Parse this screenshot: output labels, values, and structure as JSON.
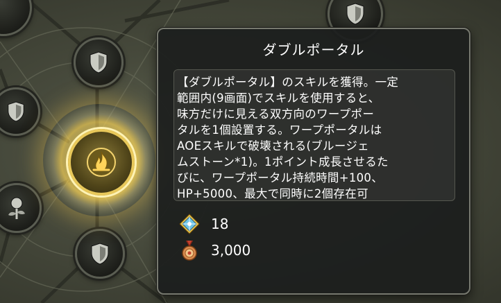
{
  "skill_tree": {
    "selected_skill_icon": "flame-emblem-icon",
    "locked_node_icon": "shield-icon",
    "other_node_icon": "rose-icon",
    "highlight_color": "#f2d36a"
  },
  "tooltip": {
    "title": "ダブルポータル",
    "description_lines": [
      "【ダブルポータル】のスキルを獲得。一定",
      "範囲内(9画面)でスキルを使用すると、",
      "味方だけに見える双方向のワープポー",
      "タルを1個設置する。ワープポータルは",
      "AOEスキルで破壊される(ブルージェ",
      "ムストーン*1)。1ポイント成長させるた",
      "びに、ワープポータル持続時間+100、",
      "HP+5000、最大で同時に2個存在可"
    ],
    "costs": [
      {
        "icon": "gem-crystal-icon",
        "value": "18"
      },
      {
        "icon": "medal-icon",
        "value": "3,000"
      }
    ]
  }
}
